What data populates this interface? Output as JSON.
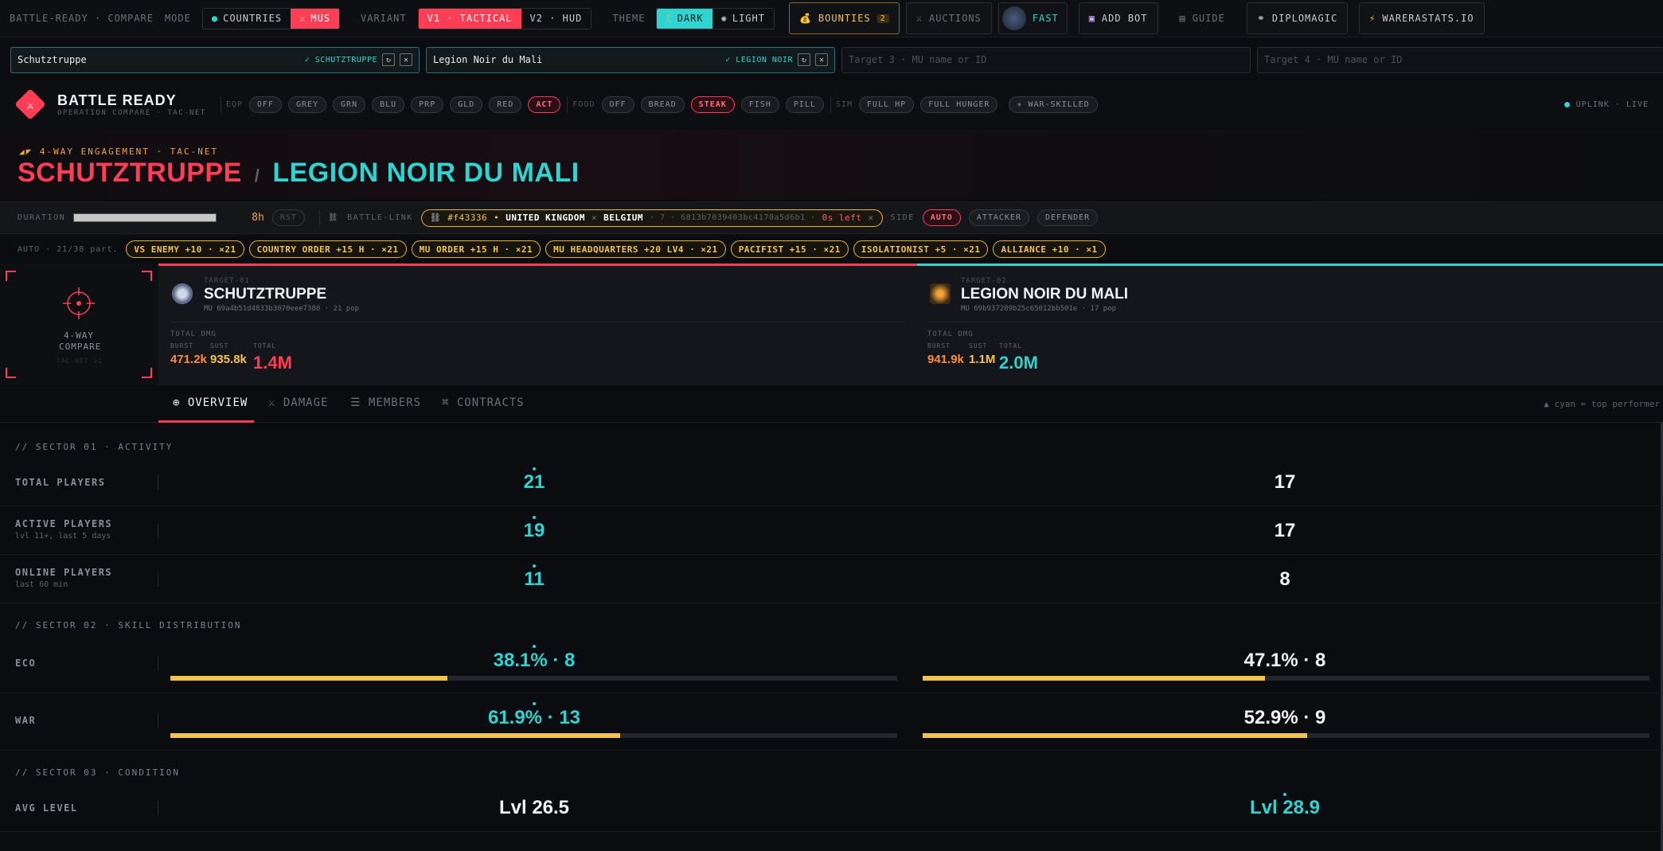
{
  "topbar": {
    "brand": "BATTLE-READY · COMPARE",
    "mode_label": "MODE",
    "mode_options": [
      "COUNTRIES",
      "MUS"
    ],
    "variant_label": "VARIANT",
    "variant_options": [
      "V1 · TACTICAL",
      "V2 · HUD"
    ],
    "theme_label": "THEME",
    "theme_options": [
      "DARK",
      "LIGHT"
    ],
    "bounties": "BOUNTIES",
    "bounties_count": "2",
    "auctions": "AUCTIONS",
    "fast": "FAST",
    "add_bot": "ADD BOT",
    "guide": "GUIDE",
    "diplomagic": "DIPLOMAGIC",
    "warerastats": "WARERASTATS.IO"
  },
  "search": {
    "s1_value": "Schutztruppe",
    "s1_tag": "✓ SCHUTZTRUPPE",
    "s2_value": "Legion Noir du Mali",
    "s2_tag": "✓ LEGION NOIR",
    "s3_placeholder": "Target 3 · MU name or ID",
    "s4_placeholder": "Target 4 · MU name or ID"
  },
  "header": {
    "app_title": "BATTLE READY",
    "app_subtitle": "OPERATION COMPARE · TAC-NET",
    "eqp_label": "EQP",
    "eqp": [
      "OFF",
      "GREY",
      "GRN",
      "BLU",
      "PRP",
      "GLD",
      "RED",
      "ACT"
    ],
    "food_label": "FOOD",
    "food": [
      "OFF",
      "BREAD",
      "STEAK",
      "FISH",
      "PILL"
    ],
    "sim_label": "SIM",
    "sim": [
      "FULL HP",
      "FULL HUNGER"
    ],
    "war_skilled": "✳ WAR-SKILLED",
    "uplink": "UPLINK · LIVE"
  },
  "band": {
    "kicker": "4-WAY ENGAGEMENT · TAC-NET",
    "name1": "SCHUTZTRUPPE",
    "slash": "/",
    "name2": "LEGION NOIR DU MALI"
  },
  "duration": {
    "label": "DURATION",
    "value": "8h",
    "rst": "RST",
    "battle_link_label": "BATTLE-LINK",
    "battle_id": "#f43336",
    "country_a": "UNITED KINGDOM",
    "vs": "×",
    "country_b": "BELGIUM",
    "hash": "· ? · 6813b7039403bc4170a5d6b1 ·",
    "time_left": "0s left",
    "side_label": "SIDE",
    "sides": [
      "AUTO",
      "ATTACKER",
      "DEFENDER"
    ]
  },
  "bonuses": {
    "auto_label": "AUTO · 21/38 part.",
    "items": [
      "VS ENEMY +10 · ×21",
      "COUNTRY ORDER +15 H · ×21",
      "MU ORDER +15 H · ×21",
      "MU HEADQUARTERS +20 LV4 · ×21",
      "PACIFIST +15 · ×21",
      "ISOLATIONIST +5 · ×21",
      "ALLIANCE +10 · ×1"
    ]
  },
  "card": {
    "reticle_title": "4-WAY COMPARE",
    "reticle_sub": "TAC-NET v1",
    "t1": {
      "tag": "TARGET-01",
      "name": "SCHUTZTRUPPE",
      "meta": "MU 69a4b51d4833b3070eee7380 · 21 pop",
      "total_dmg_label": "TOTAL DMG",
      "burst_label": "BURST",
      "sust_label": "SUST",
      "total_label": "TOTAL",
      "burst": "471.2k",
      "sust": "935.8k",
      "total": "1.4M"
    },
    "t2": {
      "tag": "TARGET-02",
      "name": "LEGION NOIR DU MALI",
      "meta": "MU 69b937289b25c65012bb501e · 17 pop",
      "total_dmg_label": "TOTAL DMG",
      "burst_label": "BURST",
      "sust_label": "SUST",
      "total_label": "TOTAL",
      "burst": "941.9k",
      "sust": "1.1M",
      "total": "2.0M"
    }
  },
  "tabs": {
    "overview": "OVERVIEW",
    "damage": "DAMAGE",
    "members": "MEMBERS",
    "contracts": "CONTRACTS",
    "legend": "▲ cyan = top performer"
  },
  "sectors": {
    "s1": "// SECTOR 01 · ACTIVITY",
    "s2": "// SECTOR 02 · SKILL DISTRIBUTION",
    "s3": "// SECTOR 03 · CONDITION"
  },
  "rows": {
    "total_players": {
      "label": "TOTAL PLAYERS",
      "a": "21",
      "b": "17"
    },
    "active_players": {
      "label": "ACTIVE PLAYERS",
      "sub": "lvl 11+, last 5 days",
      "a": "19",
      "b": "17"
    },
    "online_players": {
      "label": "ONLINE PLAYERS",
      "sub": "last 60 min",
      "a": "11",
      "b": "8"
    },
    "eco": {
      "label": "ECO",
      "a": "38.1% · 8",
      "b": "47.1% · 8",
      "a_frac": 0.381,
      "b_frac": 0.471
    },
    "war": {
      "label": "WAR",
      "a": "61.9% · 13",
      "b": "52.9% · 9",
      "a_frac": 0.619,
      "b_frac": 0.529
    },
    "avg_level": {
      "label": "AVG LEVEL",
      "a": "Lvl 26.5",
      "b": "Lvl 28.9"
    }
  },
  "colors": {
    "red": "#ff3d55",
    "cyan": "#2fd3d0",
    "gold": "#f3c34b",
    "bg": "#0b0c0f"
  }
}
